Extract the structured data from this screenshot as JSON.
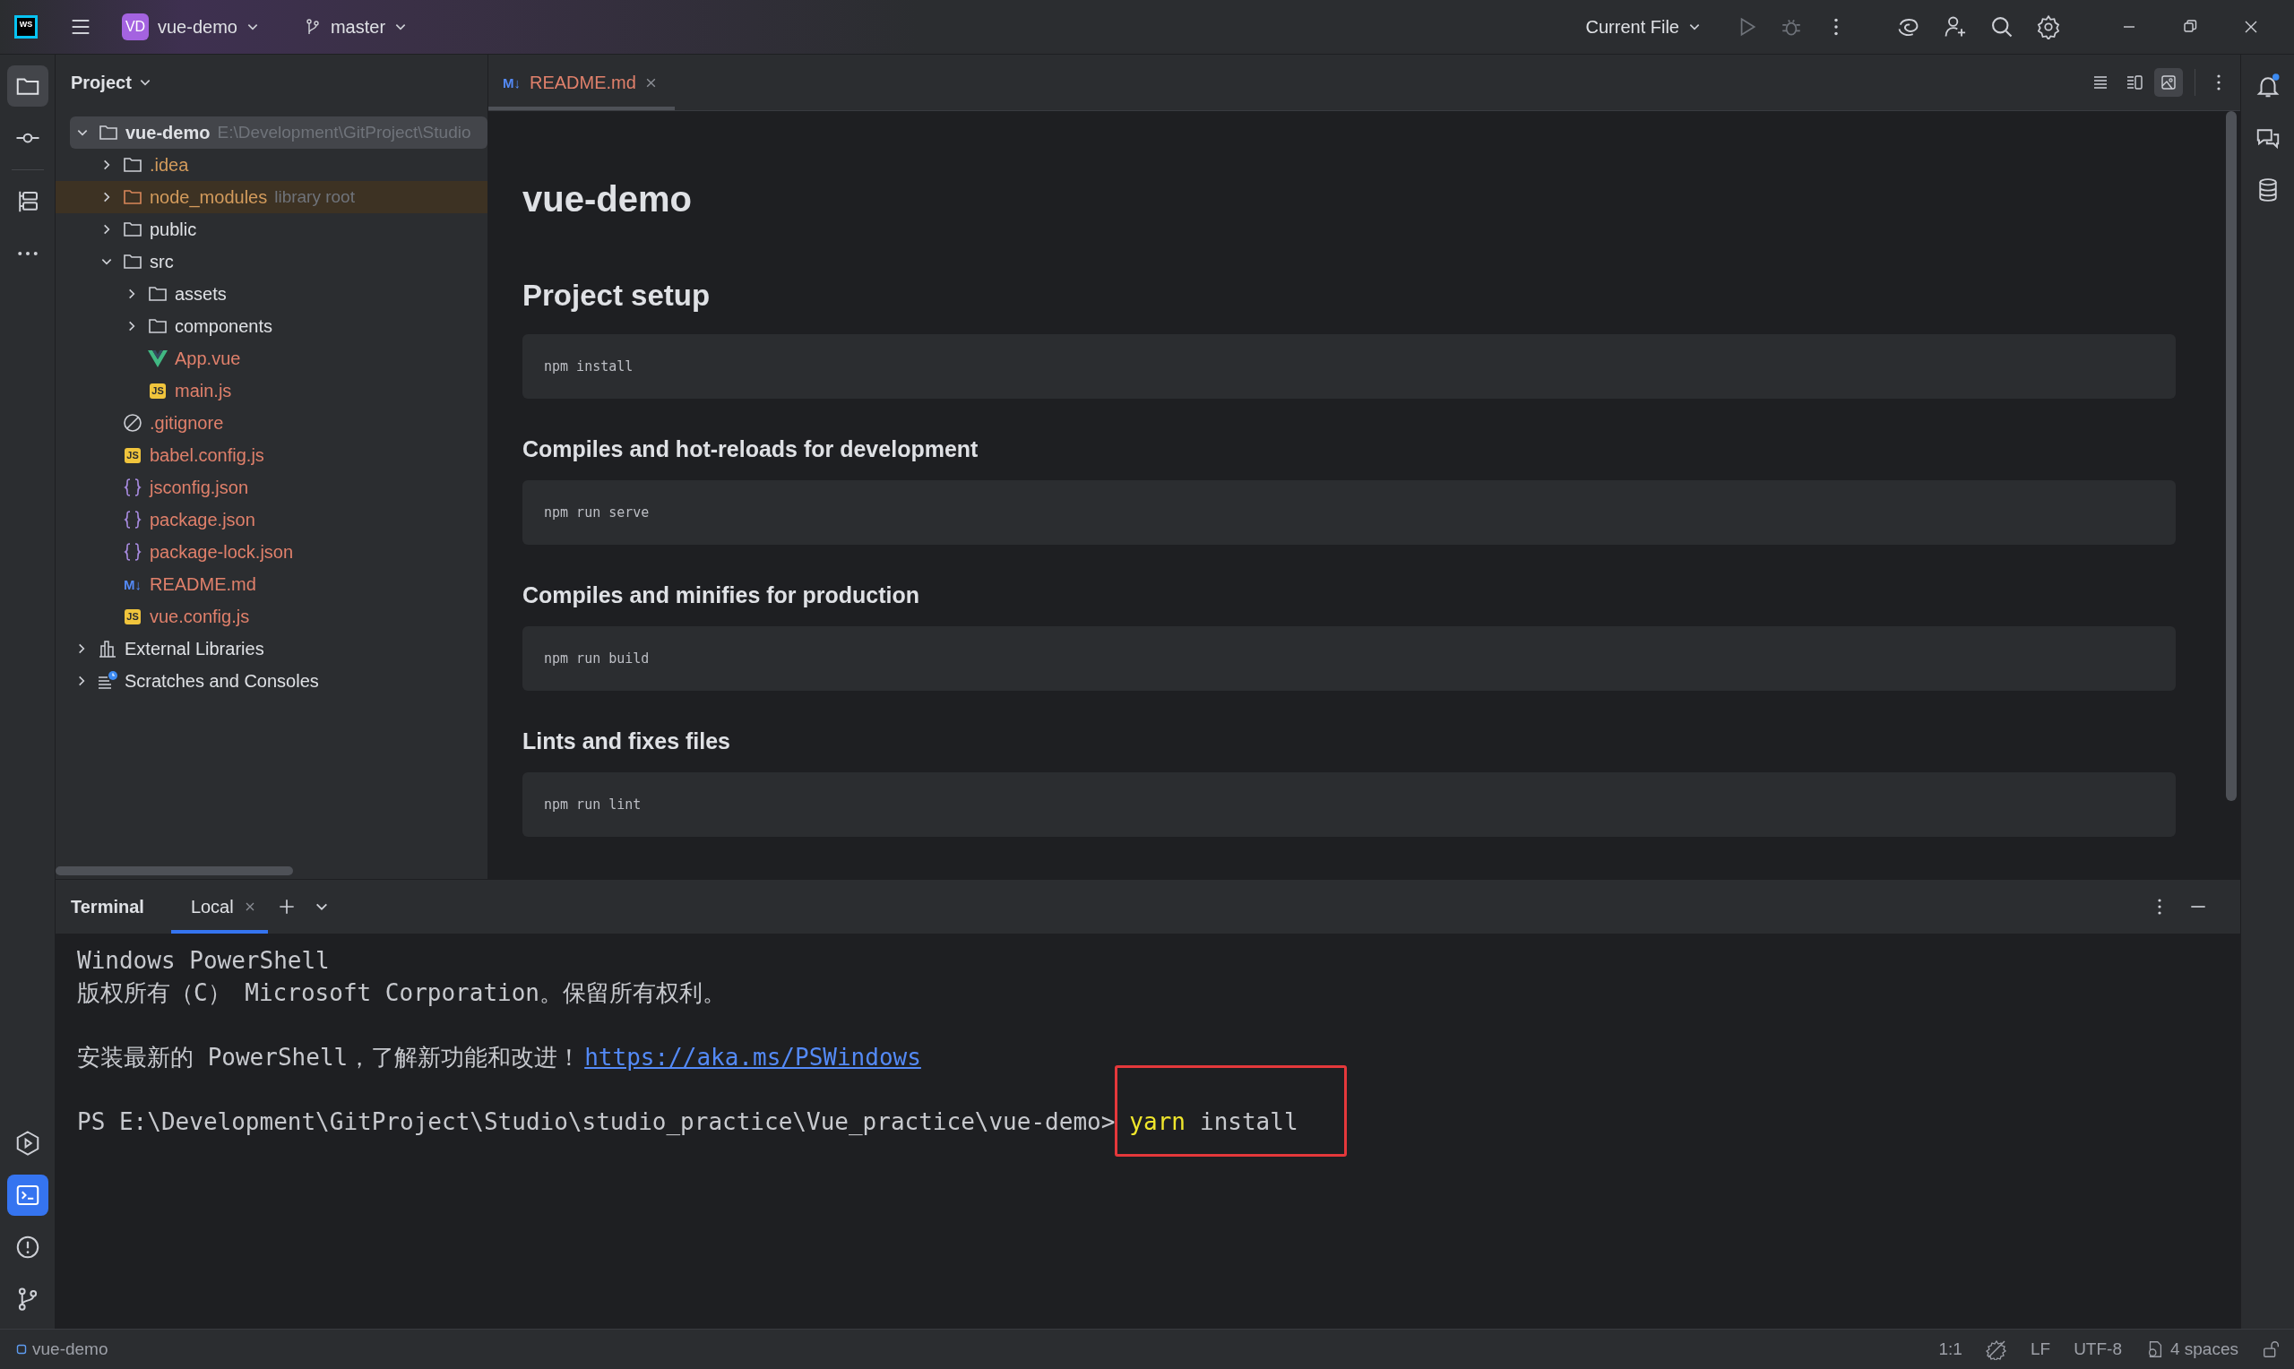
{
  "title_bar": {
    "logo": "WS",
    "project_badge": "VD",
    "project": "vue-demo",
    "branch": "master",
    "run_config": "Current File"
  },
  "project_panel": {
    "title": "Project",
    "tree": [
      {
        "name": "vue-demo",
        "hint": "E:\\Development\\GitProject\\Studio",
        "kind": "folder",
        "color": "#dfe1e5",
        "bold": true,
        "expanded": true,
        "selected": true,
        "children": [
          {
            "name": ".idea",
            "kind": "folder",
            "color": "#d39b5c",
            "expanded": false,
            "selected": false
          },
          {
            "name": "node_modules",
            "hint": "library root",
            "kind": "library_folder",
            "color": "#d39b5c",
            "expanded": false,
            "selected": false
          },
          {
            "name": "public",
            "kind": "folder",
            "color": "#dfe1e5",
            "expanded": false,
            "selected": false
          },
          {
            "name": "src",
            "kind": "folder",
            "color": "#dfe1e5",
            "expanded": true,
            "selected": false,
            "children": [
              {
                "name": "assets",
                "kind": "folder",
                "color": "#dfe1e5",
                "expanded": false,
                "selected": false
              },
              {
                "name": "components",
                "kind": "folder",
                "color": "#dfe1e5",
                "expanded": false,
                "selected": false
              },
              {
                "name": "App.vue",
                "kind": "vue",
                "color": "#e0806b",
                "selected": false
              },
              {
                "name": "main.js",
                "kind": "js",
                "badge": "JS",
                "color": "#e0806b",
                "selected": false
              }
            ]
          },
          {
            "name": ".gitignore",
            "kind": "ignore",
            "color": "#e0806b",
            "selected": false
          },
          {
            "name": "babel.config.js",
            "kind": "js",
            "badge": "JS",
            "color": "#e0806b",
            "selected": false
          },
          {
            "name": "jsconfig.json",
            "kind": "json",
            "color": "#e0806b",
            "selected": false
          },
          {
            "name": "package.json",
            "kind": "json",
            "color": "#e0806b",
            "selected": false
          },
          {
            "name": "package-lock.json",
            "kind": "json",
            "color": "#e0806b",
            "selected": false
          },
          {
            "name": "README.md",
            "kind": "md",
            "badge": "M↓",
            "color": "#e0806b",
            "selected": false
          },
          {
            "name": "vue.config.js",
            "kind": "js",
            "badge": "JS",
            "color": "#e0806b",
            "selected": false
          }
        ]
      },
      {
        "name": "External Libraries",
        "kind": "libraries",
        "color": "#dfe1e5",
        "expanded": false,
        "selected": false
      },
      {
        "name": "Scratches and Consoles",
        "kind": "scratches",
        "color": "#dfe1e5",
        "expanded": false,
        "selected": false
      }
    ]
  },
  "editor": {
    "tabs": [
      {
        "label": "README.md",
        "badge": "M↓",
        "selected": true
      }
    ],
    "view_modes": [
      {
        "kind": "code",
        "selected": false
      },
      {
        "kind": "split",
        "selected": false
      },
      {
        "kind": "preview",
        "selected": true
      }
    ],
    "blocks": [
      {
        "kind": "h1",
        "text": "vue-demo"
      },
      {
        "kind": "h2",
        "text": "Project setup"
      },
      {
        "kind": "code",
        "text": "npm install"
      },
      {
        "kind": "h3",
        "text": "Compiles and hot-reloads for development"
      },
      {
        "kind": "code",
        "text": "npm run serve"
      },
      {
        "kind": "h3",
        "text": "Compiles and minifies for production"
      },
      {
        "kind": "code",
        "text": "npm run build"
      },
      {
        "kind": "h3",
        "text": "Lints and fixes files"
      },
      {
        "kind": "code",
        "text": "npm run lint"
      }
    ]
  },
  "terminal": {
    "title": "Terminal",
    "tabs": [
      {
        "label": "Local",
        "selected": true
      }
    ],
    "lines": [
      {
        "segments": [
          {
            "kind": "text",
            "text": "Windows PowerShell"
          }
        ]
      },
      {
        "blank_before": false,
        "segments": [
          {
            "kind": "text",
            "text": "版权所有（C） Microsoft Corporation。保留所有权利。"
          }
        ]
      },
      {
        "blank_before": true,
        "segments": [
          {
            "kind": "text",
            "text": "安装最新的 PowerShell，了解新功能和改进！"
          },
          {
            "kind": "link",
            "text": "https://aka.ms/PSWindows"
          }
        ]
      },
      {
        "blank_before": true,
        "segments": [
          {
            "kind": "text",
            "text": "PS E:\\Development\\GitProject\\Studio\\studio_practice\\Vue_practice\\vue-demo>"
          },
          {
            "kind": "command",
            "program": "yarn",
            "args": "install",
            "boxed": true
          }
        ]
      }
    ]
  },
  "status_bar": {
    "project": "vue-demo",
    "position": "1:1",
    "line_separator": "LF",
    "encoding": "UTF-8",
    "indent": "4 spaces"
  }
}
